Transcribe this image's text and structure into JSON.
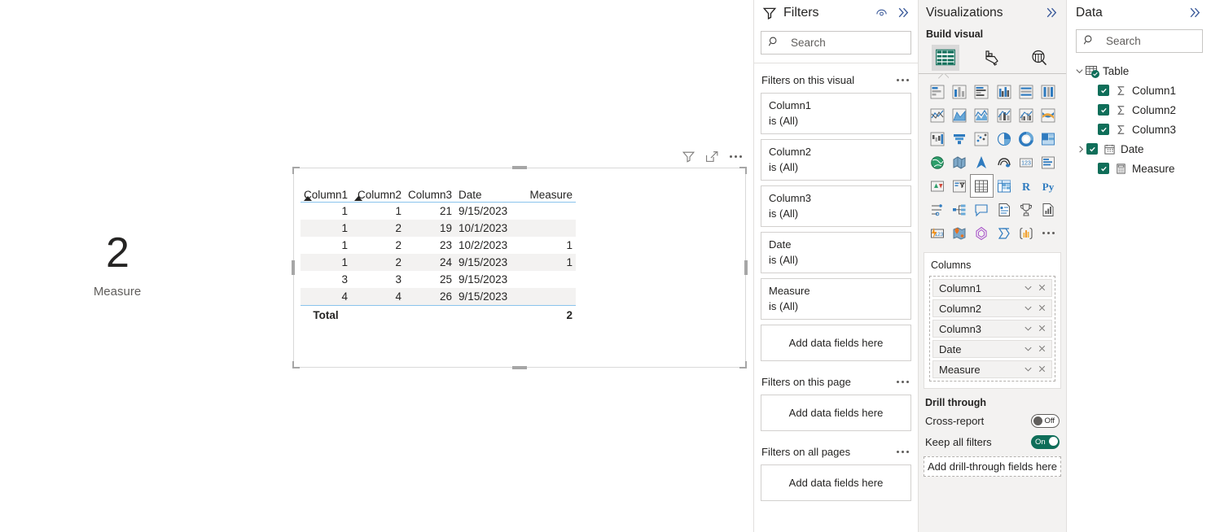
{
  "canvas": {
    "card_visual": {
      "value": "2",
      "label": "Measure"
    },
    "table_visual": {
      "header_icons": [
        "filter-icon",
        "focus-mode-icon",
        "more-options-icon"
      ],
      "columns": [
        "Column1",
        "Column2",
        "Column3",
        "Date",
        "Measure"
      ],
      "sorted_columns": [
        "Column1",
        "Column2"
      ],
      "rows": [
        [
          "1",
          "1",
          "21",
          "9/15/2023",
          ""
        ],
        [
          "1",
          "2",
          "19",
          "10/1/2023",
          ""
        ],
        [
          "1",
          "2",
          "23",
          "10/2/2023",
          "1"
        ],
        [
          "1",
          "2",
          "24",
          "9/15/2023",
          "1"
        ],
        [
          "3",
          "3",
          "25",
          "9/15/2023",
          ""
        ],
        [
          "4",
          "4",
          "26",
          "9/15/2023",
          ""
        ]
      ],
      "total_label": "Total",
      "total_value": "2"
    }
  },
  "filters_pane": {
    "title": "Filters",
    "search_placeholder": "Search",
    "sections": [
      {
        "title": "Filters on this visual",
        "cards": [
          {
            "name": "Column1",
            "state": "is (All)"
          },
          {
            "name": "Column2",
            "state": "is (All)"
          },
          {
            "name": "Column3",
            "state": "is (All)"
          },
          {
            "name": "Date",
            "state": "is (All)"
          },
          {
            "name": "Measure",
            "state": "is (All)"
          }
        ],
        "drop_label": "Add data fields here"
      },
      {
        "title": "Filters on this page",
        "cards": [],
        "drop_label": "Add data fields here"
      },
      {
        "title": "Filters on all pages",
        "cards": [],
        "drop_label": "Add data fields here"
      }
    ]
  },
  "visualizations_pane": {
    "title": "Visualizations",
    "subtitle": "Build visual",
    "tabs": [
      {
        "name": "build-visual-tab",
        "icon": "fields-table-icon",
        "active": true
      },
      {
        "name": "format-visual-tab",
        "icon": "paintbrush-icon",
        "active": false
      },
      {
        "name": "analytics-tab",
        "icon": "analytics-magnifier-icon",
        "active": false
      }
    ],
    "visual_types": [
      "stacked-bar-chart",
      "stacked-column-chart",
      "clustered-bar-chart",
      "clustered-column-chart",
      "100-stacked-bar-chart",
      "100-stacked-column-chart",
      "line-chart",
      "area-chart",
      "stacked-area-chart",
      "line-and-stacked-column-chart",
      "line-and-clustered-column-chart",
      "ribbon-chart",
      "waterfall-chart",
      "funnel-chart",
      "scatter-chart",
      "pie-chart",
      "donut-chart",
      "treemap",
      "map",
      "filled-map",
      "azure-map",
      "arcgis-map",
      "card",
      "multi-row-card",
      "kpi",
      "slicer",
      "table",
      "matrix",
      "r-script-visual",
      "python-visual",
      "key-influencers",
      "decomposition-tree",
      "q-and-a",
      "narrative",
      "paginated-report",
      "metrics",
      "power-apps",
      "arcgis-for-power-bi",
      "power-automate",
      "azure-synapse",
      "get-more-visuals",
      "more-options"
    ],
    "selected_visual_type": "table",
    "columns_well": {
      "title": "Columns",
      "fields": [
        "Column1",
        "Column2",
        "Column3",
        "Date",
        "Measure"
      ]
    },
    "drill_through": {
      "title": "Drill through",
      "cross_report": {
        "label": "Cross-report",
        "state": "Off",
        "on": false
      },
      "keep_all_filters": {
        "label": "Keep all filters",
        "state": "On",
        "on": true
      },
      "drop_label": "Add drill-through fields here"
    }
  },
  "data_pane": {
    "title": "Data",
    "search_placeholder": "Search",
    "tree": {
      "table_name": "Table",
      "expanded": true,
      "fields": [
        {
          "name": "Column1",
          "icon": "sigma-icon",
          "checked": true,
          "expandable": false
        },
        {
          "name": "Column2",
          "icon": "sigma-icon",
          "checked": true,
          "expandable": false
        },
        {
          "name": "Column3",
          "icon": "sigma-icon",
          "checked": true,
          "expandable": false
        },
        {
          "name": "Date",
          "icon": "calendar-icon",
          "checked": true,
          "expandable": true
        },
        {
          "name": "Measure",
          "icon": "calculator-icon",
          "checked": true,
          "expandable": false
        }
      ]
    }
  },
  "colors": {
    "accent_teal": "#0f6e59",
    "selection_blue": "#8ac4ec",
    "pane_gray": "#f3f2f1",
    "border_gray": "#e1dfdd",
    "text": "#252423",
    "muted_text": "#605e5c"
  }
}
